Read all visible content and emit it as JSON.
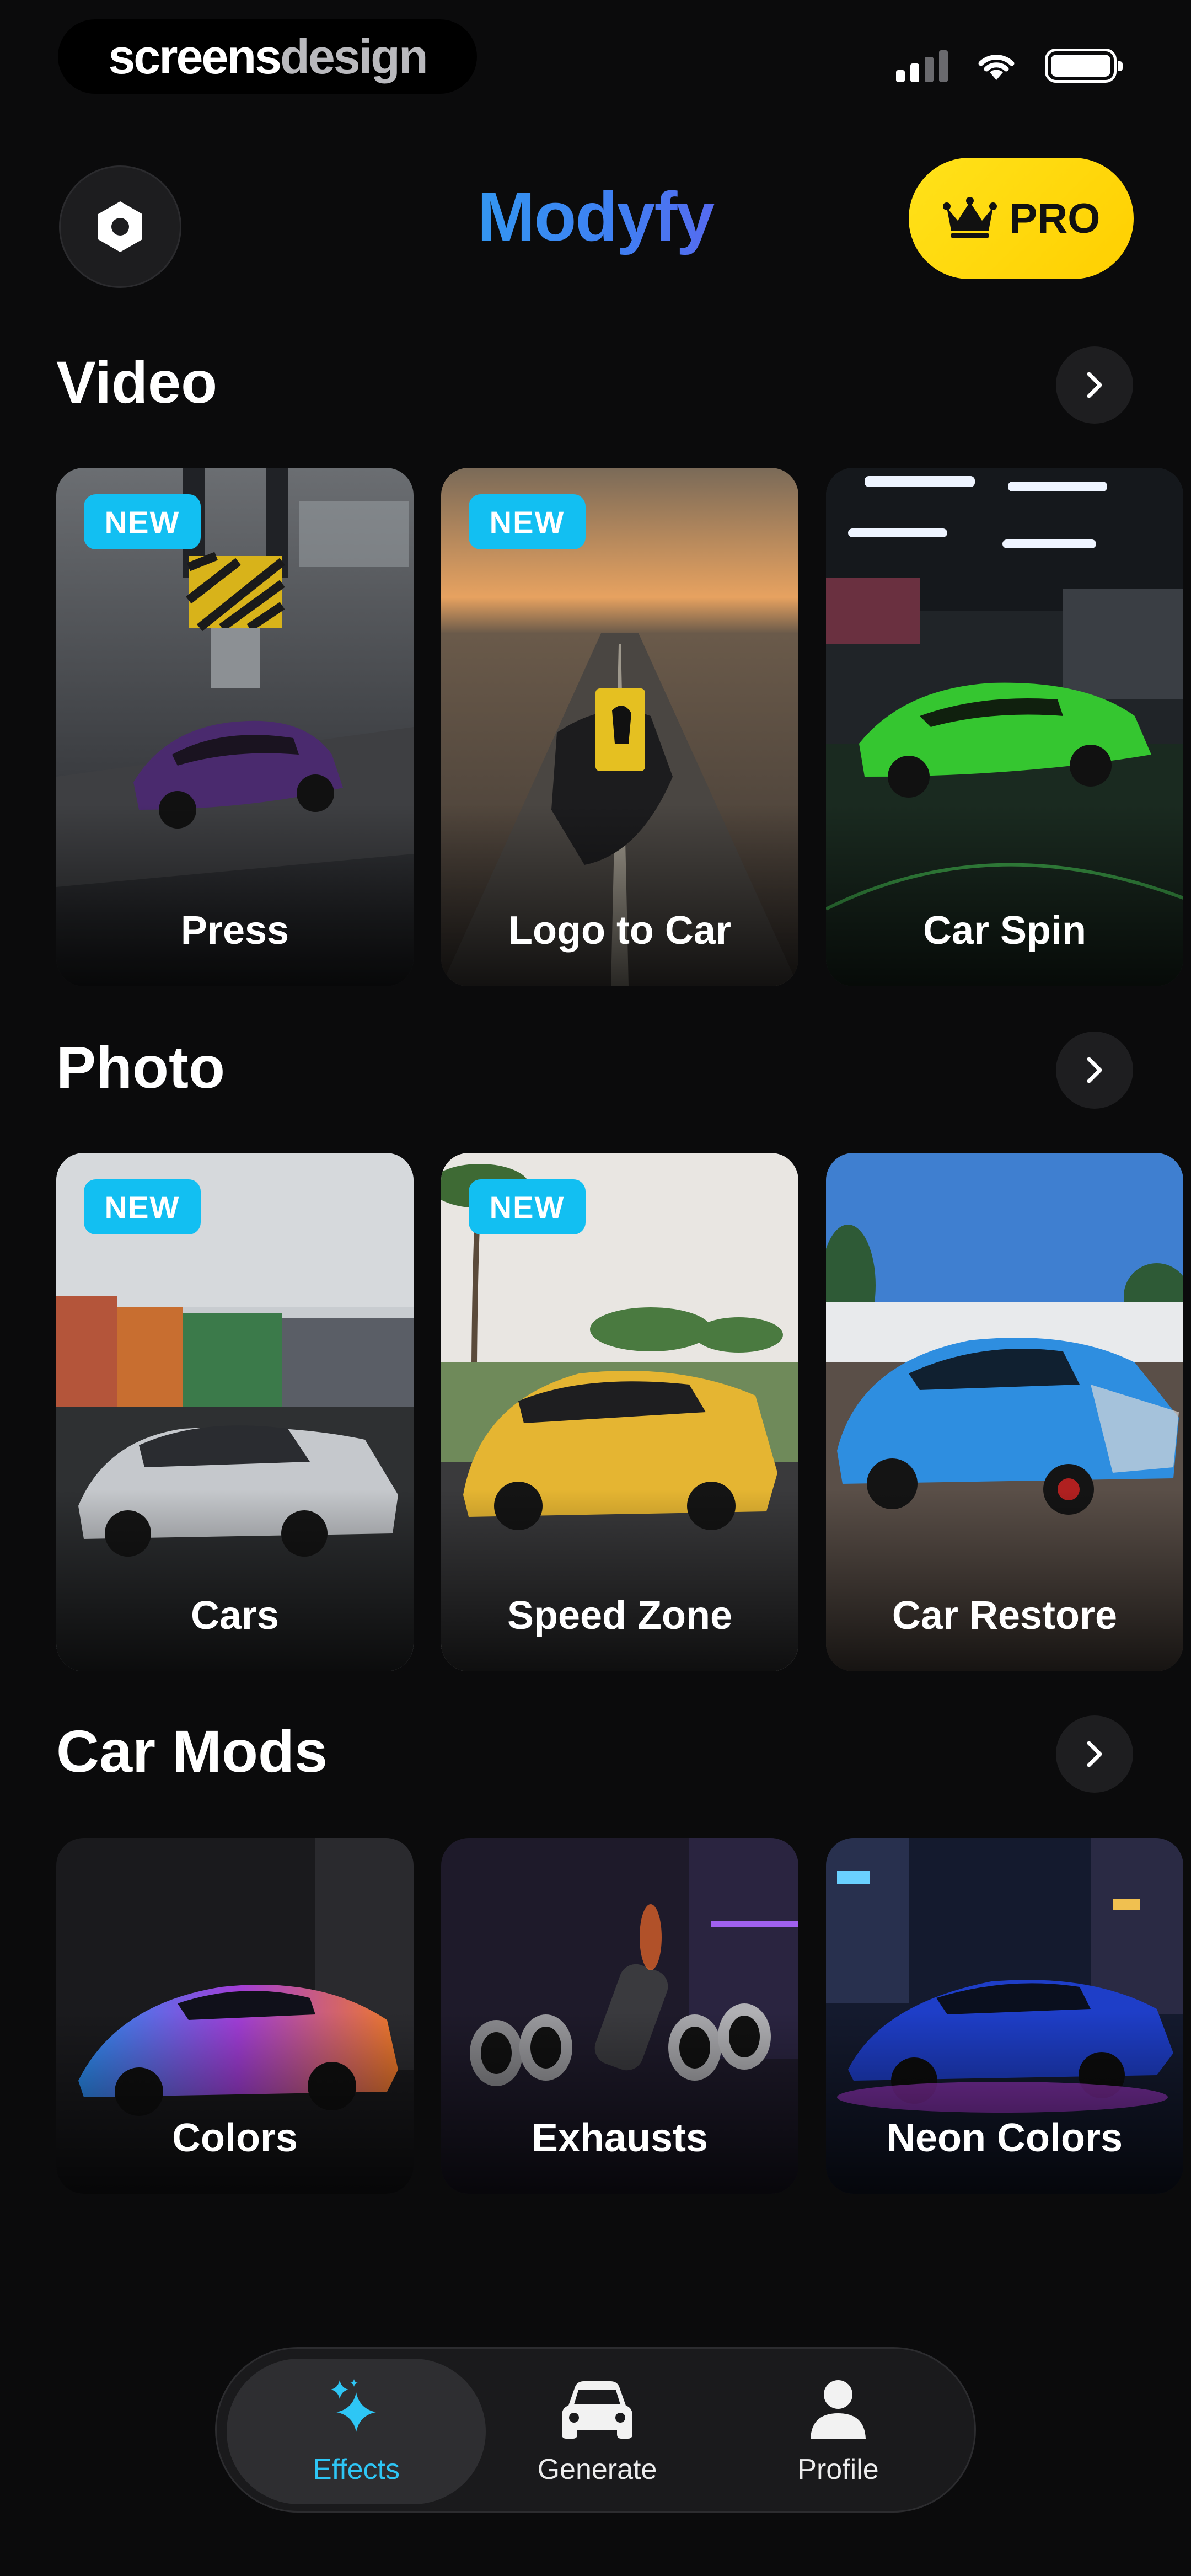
{
  "status_bar": {
    "brand_part1": "screens",
    "brand_part2": "design"
  },
  "header": {
    "title": "Modyfy",
    "pro_label": "PRO",
    "settings_icon": "gear-icon",
    "pro_icon": "crown-icon"
  },
  "sections": {
    "video": {
      "title": "Video",
      "cards": [
        {
          "label": "Press",
          "badge": "NEW"
        },
        {
          "label": "Logo to Car",
          "badge": "NEW"
        },
        {
          "label": "Car Spin"
        }
      ]
    },
    "photo": {
      "title": "Photo",
      "cards": [
        {
          "label": "Cars",
          "badge": "NEW"
        },
        {
          "label": "Speed Zone",
          "badge": "NEW"
        },
        {
          "label": "Car Restore"
        }
      ]
    },
    "car_mods": {
      "title": "Car Mods",
      "cards": [
        {
          "label": "Colors"
        },
        {
          "label": "Exhausts"
        },
        {
          "label": "Neon Colors"
        }
      ]
    }
  },
  "tab_bar": {
    "tabs": [
      {
        "label": "Effects",
        "icon": "sparkles-icon",
        "active": true
      },
      {
        "label": "Generate",
        "icon": "car-icon",
        "active": false
      },
      {
        "label": "Profile",
        "icon": "person-icon",
        "active": false
      }
    ]
  },
  "colors": {
    "background": "#0b0b0c",
    "accent_cyan": "#2ec6f5",
    "badge_blue": "#12bff2",
    "pro_yellow": "#ffd600",
    "title_gradient_start": "#2aa7f0",
    "title_gradient_end": "#6e55ec"
  }
}
